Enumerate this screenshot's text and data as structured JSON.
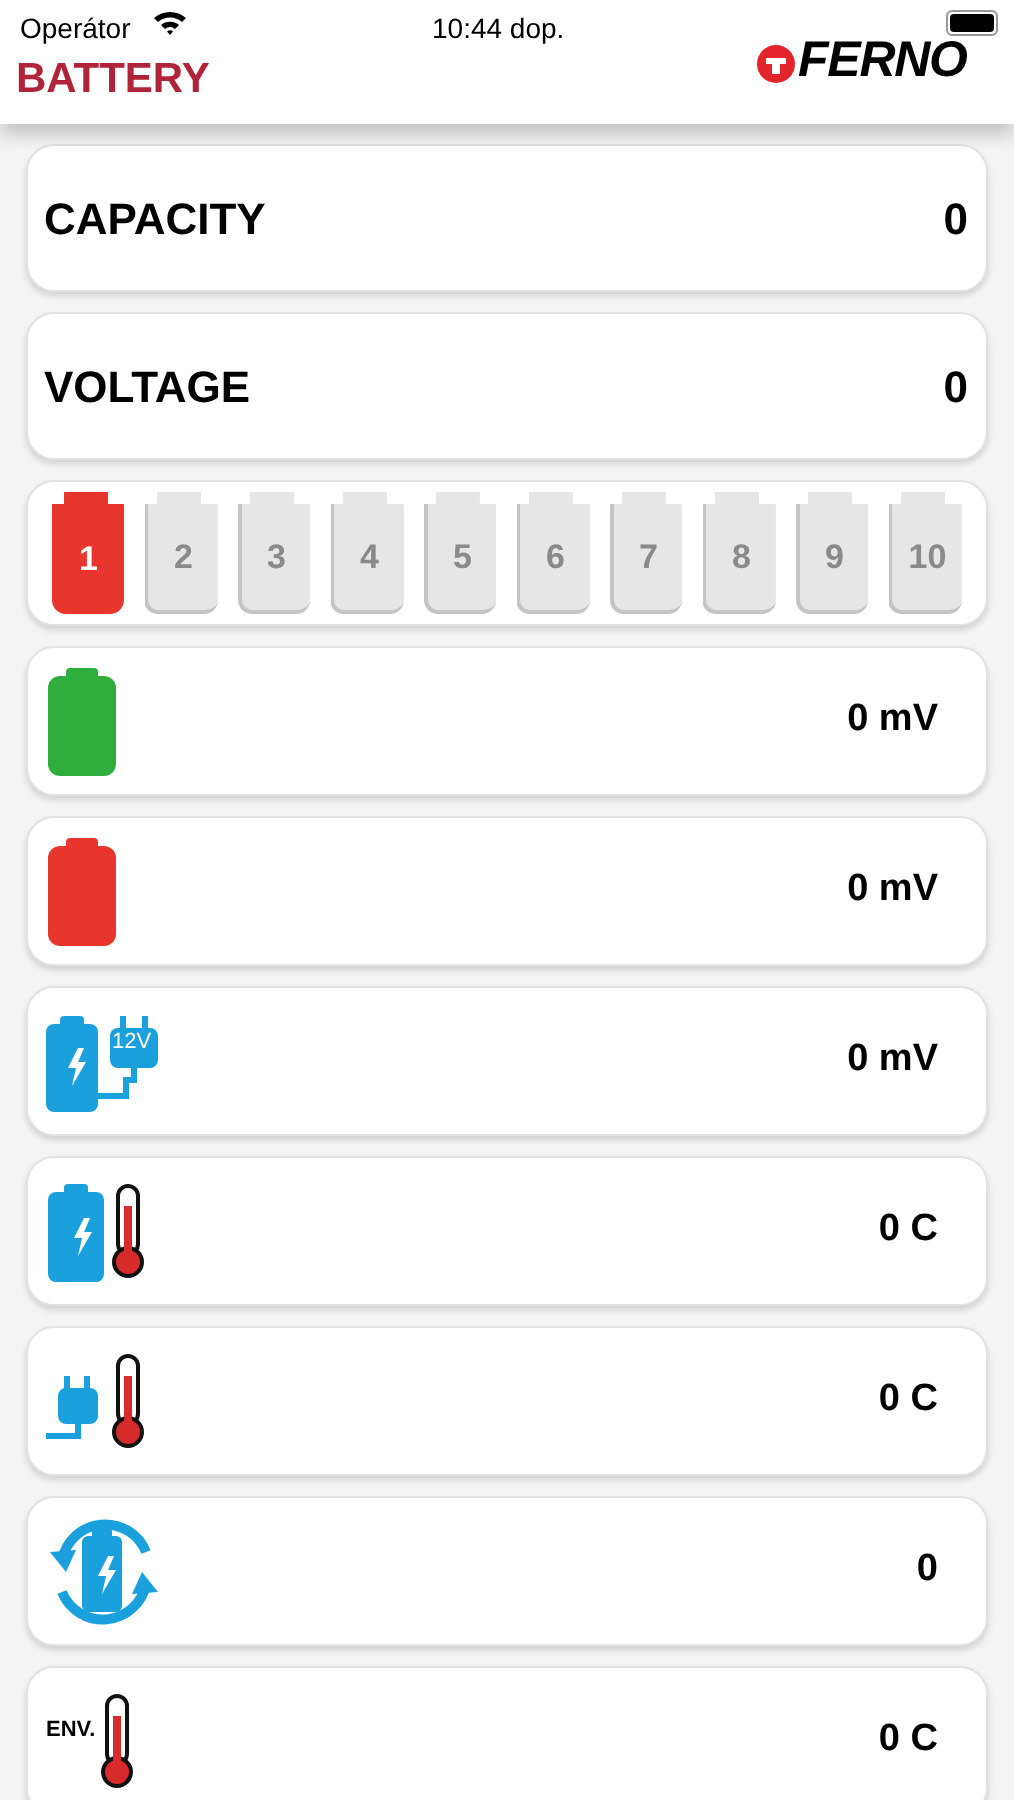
{
  "status_bar": {
    "carrier": "Operátor",
    "time": "10:44 dop."
  },
  "header": {
    "title": "BATTERY",
    "logo_text": "FERNO"
  },
  "summary": [
    {
      "label": "CAPACITY",
      "value": "0"
    },
    {
      "label": "VOLTAGE",
      "value": "0"
    }
  ],
  "batteries": [
    {
      "label": "1",
      "selected": true
    },
    {
      "label": "2",
      "selected": false
    },
    {
      "label": "3",
      "selected": false
    },
    {
      "label": "4",
      "selected": false
    },
    {
      "label": "5",
      "selected": false
    },
    {
      "label": "6",
      "selected": false
    },
    {
      "label": "7",
      "selected": false
    },
    {
      "label": "8",
      "selected": false
    },
    {
      "label": "9",
      "selected": false
    },
    {
      "label": "10",
      "selected": false
    }
  ],
  "readings": [
    {
      "kind": "battery-green",
      "value": "0 mV"
    },
    {
      "kind": "battery-red",
      "value": "0 mV"
    },
    {
      "kind": "charger",
      "icon_text": "12V",
      "value": "0 mV"
    },
    {
      "kind": "battery-temp",
      "value": "0 C"
    },
    {
      "kind": "plug-temp",
      "value": "0 C"
    },
    {
      "kind": "cycle",
      "value": "0"
    },
    {
      "kind": "env-temp",
      "icon_text": "ENV.",
      "value": "0 C"
    }
  ]
}
